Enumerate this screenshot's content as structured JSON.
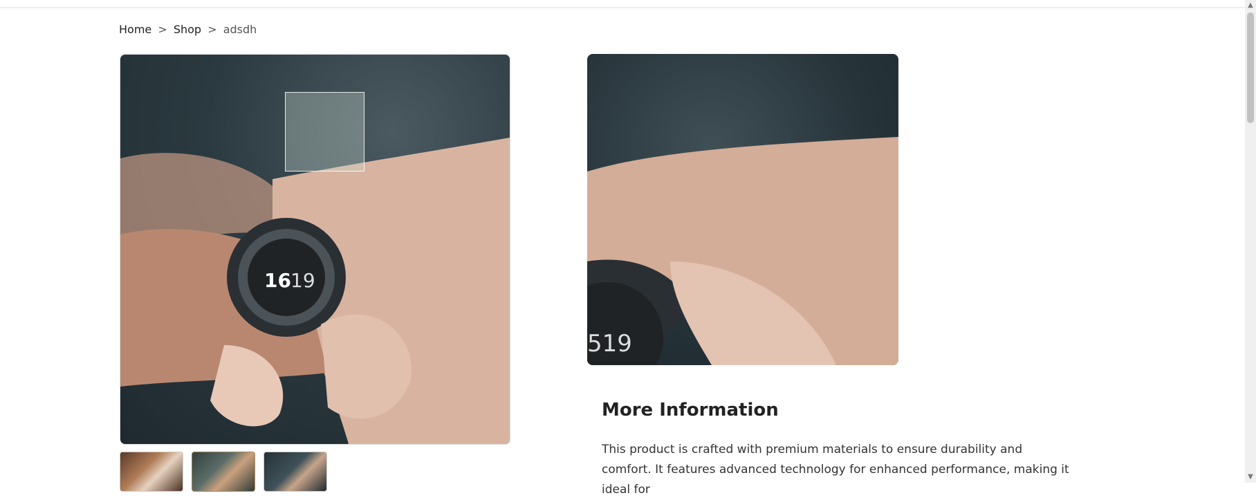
{
  "breadcrumb": {
    "home": "Home",
    "shop": "Shop",
    "separator": ">",
    "current": "adsdh"
  },
  "gallery": {
    "main_image_icon": "watch-photo",
    "thumbnails": [
      {
        "icon": "watch-photo-thumbnail"
      },
      {
        "icon": "watch-photo-thumbnail"
      },
      {
        "icon": "watch-photo-thumbnail"
      }
    ],
    "zoom_lens_icon": "zoom-lens"
  },
  "more_info": {
    "title": "More Information",
    "description": "This product is crafted with premium materials to ensure durability and comfort. It features advanced technology for enhanced performance, making it ideal for"
  },
  "scrollbar": {
    "up_icon": "▲",
    "down_icon": "▼"
  }
}
